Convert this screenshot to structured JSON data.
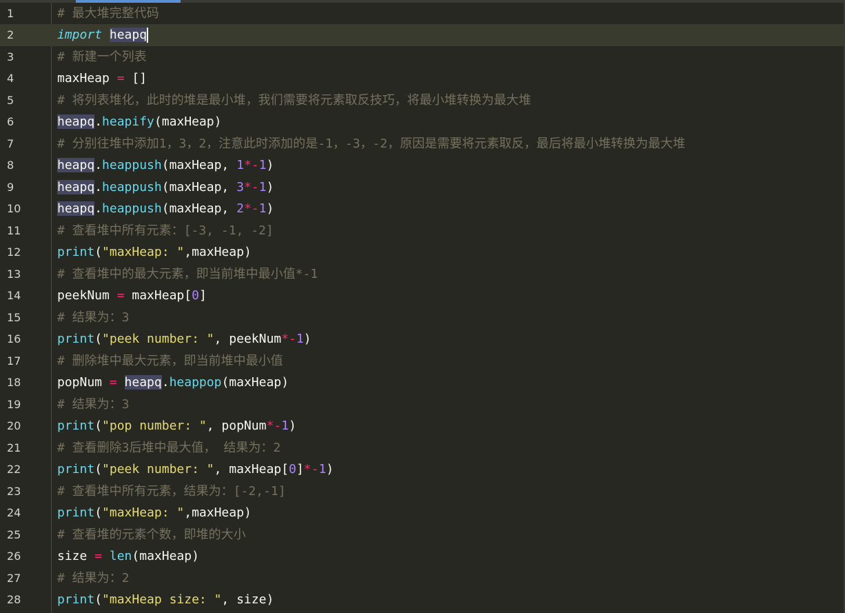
{
  "editor": {
    "language": "python",
    "theme": "monokai",
    "current_line": 2,
    "colors": {
      "background": "#272822",
      "comment": "#75715e",
      "keyword": "#66d9ef",
      "operator": "#f92672",
      "number": "#ae81ff",
      "string": "#e6db74",
      "text": "#f8f8f2",
      "selection_highlight": "#464760",
      "current_line": "#3a3b2f"
    },
    "lines": [
      {
        "n": "1",
        "tokens": [
          {
            "t": "cm",
            "v": "# 最大堆完整代码"
          }
        ]
      },
      {
        "n": "2",
        "tokens": [
          {
            "t": "kw",
            "v": "import"
          },
          {
            "t": "pl",
            "v": " "
          },
          {
            "t": "pl",
            "v": "heapq",
            "hl": true
          }
        ]
      },
      {
        "n": "3",
        "tokens": [
          {
            "t": "cm",
            "v": "# 新建一个列表"
          }
        ]
      },
      {
        "n": "4",
        "tokens": [
          {
            "t": "pl",
            "v": "maxHeap "
          },
          {
            "t": "op",
            "v": "="
          },
          {
            "t": "pl",
            "v": " []"
          }
        ]
      },
      {
        "n": "5",
        "tokens": [
          {
            "t": "cm",
            "v": "# 将列表堆化，此时的堆是最小堆，我们需要将元素取反技巧，将最小堆转换为最大堆"
          }
        ]
      },
      {
        "n": "6",
        "tokens": [
          {
            "t": "pl",
            "v": "heapq",
            "hl": true
          },
          {
            "t": "pl",
            "v": "."
          },
          {
            "t": "fn",
            "v": "heapify"
          },
          {
            "t": "pl",
            "v": "(maxHeap)"
          }
        ]
      },
      {
        "n": "7",
        "tokens": [
          {
            "t": "cm",
            "v": "# 分别往堆中添加1，3，2，注意此时添加的是-1，-3，-2，原因是需要将元素取反，最后将最小堆转换为最大堆"
          }
        ]
      },
      {
        "n": "8",
        "tokens": [
          {
            "t": "pl",
            "v": "heapq",
            "hl": true
          },
          {
            "t": "pl",
            "v": "."
          },
          {
            "t": "fn",
            "v": "heappush"
          },
          {
            "t": "pl",
            "v": "(maxHeap, "
          },
          {
            "t": "num",
            "v": "1"
          },
          {
            "t": "op",
            "v": "*-"
          },
          {
            "t": "num",
            "v": "1"
          },
          {
            "t": "pl",
            "v": ")"
          }
        ]
      },
      {
        "n": "9",
        "tokens": [
          {
            "t": "pl",
            "v": "heapq",
            "hl": true
          },
          {
            "t": "pl",
            "v": "."
          },
          {
            "t": "fn",
            "v": "heappush"
          },
          {
            "t": "pl",
            "v": "(maxHeap, "
          },
          {
            "t": "num",
            "v": "3"
          },
          {
            "t": "op",
            "v": "*-"
          },
          {
            "t": "num",
            "v": "1"
          },
          {
            "t": "pl",
            "v": ")"
          }
        ]
      },
      {
        "n": "10",
        "tokens": [
          {
            "t": "pl",
            "v": "heapq",
            "hl": true
          },
          {
            "t": "pl",
            "v": "."
          },
          {
            "t": "fn",
            "v": "heappush"
          },
          {
            "t": "pl",
            "v": "(maxHeap, "
          },
          {
            "t": "num",
            "v": "2"
          },
          {
            "t": "op",
            "v": "*-"
          },
          {
            "t": "num",
            "v": "1"
          },
          {
            "t": "pl",
            "v": ")"
          }
        ]
      },
      {
        "n": "11",
        "tokens": [
          {
            "t": "cm",
            "v": "# 查看堆中所有元素：[-3, -1, -2]"
          }
        ]
      },
      {
        "n": "12",
        "tokens": [
          {
            "t": "fn",
            "v": "print"
          },
          {
            "t": "pl",
            "v": "("
          },
          {
            "t": "str",
            "v": "\"maxHeap: \""
          },
          {
            "t": "pl",
            "v": ",maxHeap)"
          }
        ]
      },
      {
        "n": "13",
        "tokens": [
          {
            "t": "cm",
            "v": "# 查看堆中的最大元素，即当前堆中最小值*-1"
          }
        ]
      },
      {
        "n": "14",
        "tokens": [
          {
            "t": "pl",
            "v": "peekNum "
          },
          {
            "t": "op",
            "v": "="
          },
          {
            "t": "pl",
            "v": " maxHeap["
          },
          {
            "t": "num",
            "v": "0"
          },
          {
            "t": "pl",
            "v": "]"
          }
        ]
      },
      {
        "n": "15",
        "tokens": [
          {
            "t": "cm",
            "v": "# 结果为：3"
          }
        ]
      },
      {
        "n": "16",
        "tokens": [
          {
            "t": "fn",
            "v": "print"
          },
          {
            "t": "pl",
            "v": "("
          },
          {
            "t": "str",
            "v": "\"peek number: \""
          },
          {
            "t": "pl",
            "v": ", peekNum"
          },
          {
            "t": "op",
            "v": "*-"
          },
          {
            "t": "num",
            "v": "1"
          },
          {
            "t": "pl",
            "v": ")"
          }
        ]
      },
      {
        "n": "17",
        "tokens": [
          {
            "t": "cm",
            "v": "# 删除堆中最大元素，即当前堆中最小值"
          }
        ]
      },
      {
        "n": "18",
        "tokens": [
          {
            "t": "pl",
            "v": "popNum "
          },
          {
            "t": "op",
            "v": "="
          },
          {
            "t": "pl",
            "v": " "
          },
          {
            "t": "pl",
            "v": "heapq",
            "hl": true
          },
          {
            "t": "pl",
            "v": "."
          },
          {
            "t": "fn",
            "v": "heappop"
          },
          {
            "t": "pl",
            "v": "(maxHeap)"
          }
        ]
      },
      {
        "n": "19",
        "tokens": [
          {
            "t": "cm",
            "v": "# 结果为：3"
          }
        ]
      },
      {
        "n": "20",
        "tokens": [
          {
            "t": "fn",
            "v": "print"
          },
          {
            "t": "pl",
            "v": "("
          },
          {
            "t": "str",
            "v": "\"pop number: \""
          },
          {
            "t": "pl",
            "v": ", popNum"
          },
          {
            "t": "op",
            "v": "*-"
          },
          {
            "t": "num",
            "v": "1"
          },
          {
            "t": "pl",
            "v": ")"
          }
        ]
      },
      {
        "n": "21",
        "tokens": [
          {
            "t": "cm",
            "v": "# 查看删除3后堆中最大值， 结果为：2"
          }
        ]
      },
      {
        "n": "22",
        "tokens": [
          {
            "t": "fn",
            "v": "print"
          },
          {
            "t": "pl",
            "v": "("
          },
          {
            "t": "str",
            "v": "\"peek number: \""
          },
          {
            "t": "pl",
            "v": ", maxHeap["
          },
          {
            "t": "num",
            "v": "0"
          },
          {
            "t": "pl",
            "v": "]"
          },
          {
            "t": "op",
            "v": "*-"
          },
          {
            "t": "num",
            "v": "1"
          },
          {
            "t": "pl",
            "v": ")"
          }
        ]
      },
      {
        "n": "23",
        "tokens": [
          {
            "t": "cm",
            "v": "# 查看堆中所有元素，结果为：[-2,-1]"
          }
        ]
      },
      {
        "n": "24",
        "tokens": [
          {
            "t": "fn",
            "v": "print"
          },
          {
            "t": "pl",
            "v": "("
          },
          {
            "t": "str",
            "v": "\"maxHeap: \""
          },
          {
            "t": "pl",
            "v": ",maxHeap)"
          }
        ]
      },
      {
        "n": "25",
        "tokens": [
          {
            "t": "cm",
            "v": "# 查看堆的元素个数，即堆的大小"
          }
        ]
      },
      {
        "n": "26",
        "tokens": [
          {
            "t": "pl",
            "v": "size "
          },
          {
            "t": "op",
            "v": "="
          },
          {
            "t": "pl",
            "v": " "
          },
          {
            "t": "fn",
            "v": "len"
          },
          {
            "t": "pl",
            "v": "(maxHeap)"
          }
        ]
      },
      {
        "n": "27",
        "tokens": [
          {
            "t": "cm",
            "v": "# 结果为：2"
          }
        ]
      },
      {
        "n": "28",
        "tokens": [
          {
            "t": "fn",
            "v": "print"
          },
          {
            "t": "pl",
            "v": "("
          },
          {
            "t": "str",
            "v": "\"maxHeap size: \""
          },
          {
            "t": "pl",
            "v": ", size)"
          }
        ]
      }
    ]
  }
}
